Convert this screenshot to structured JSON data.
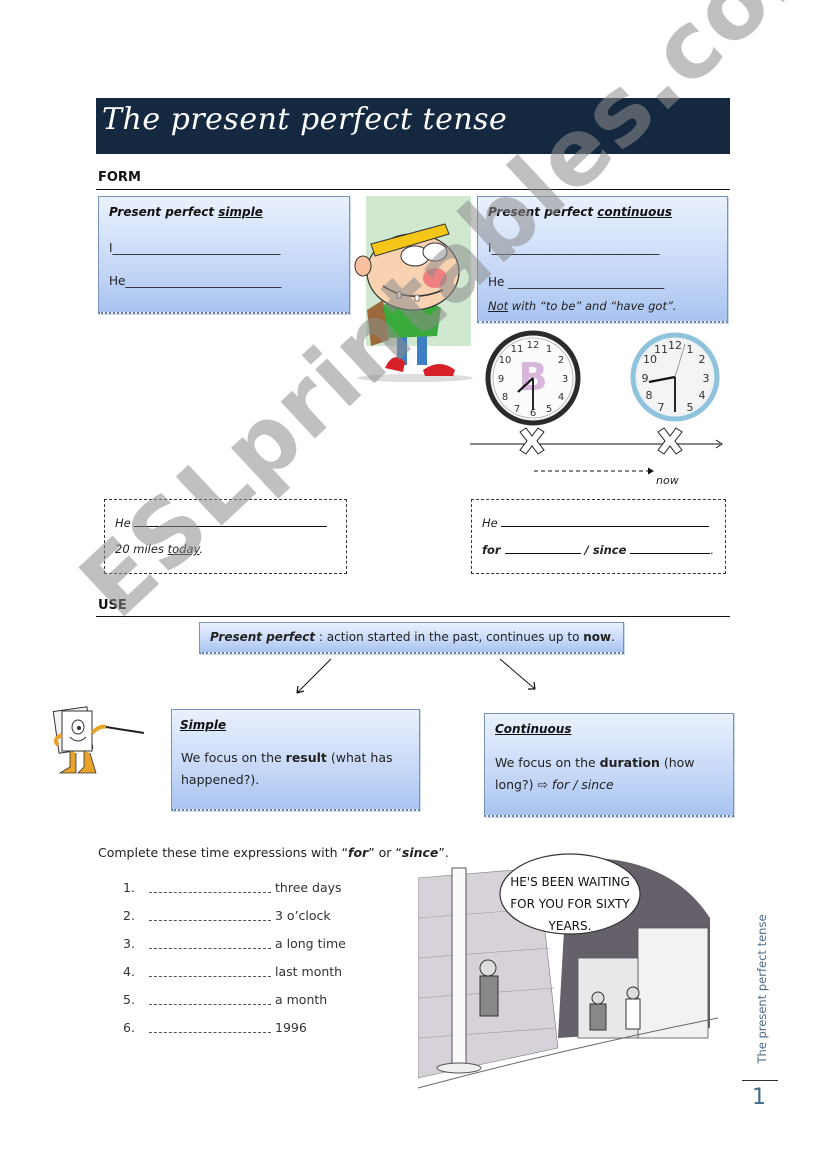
{
  "title": "The present perfect tense",
  "form": {
    "heading": "FORM",
    "simple_box": {
      "title_prefix": "Present perfect ",
      "title_emph": "simple",
      "line1_label": "I",
      "line1_blank": "____________________________",
      "line2_label": "He",
      "line2_blank": "__________________________"
    },
    "continuous_box": {
      "title_prefix": "Present perfect ",
      "title_emph": "continuous",
      "line1_label": "I",
      "line1_blank": "____________________________",
      "line2_label": "He",
      "line2_blank": " __________________________",
      "note_emph": "Not",
      "note_rest": " with “to be” and “have got”."
    },
    "timeline": {
      "now_label": "now",
      "clock_left_letter": "B"
    },
    "simple_example": {
      "line1_label": "He",
      "line2_text": "20 miles ",
      "line2_emph": "today",
      "line2_end": "."
    },
    "continuous_example": {
      "line1_label": "He",
      "for_label": "for",
      "since_label": "/ since",
      "end": "."
    }
  },
  "use": {
    "heading": "USE",
    "main_box": {
      "title": "Present perfect",
      "text": " : action started in the past, continues up to ",
      "emph": "now",
      "end": "."
    },
    "simple_box": {
      "title": "Simple",
      "text_before": "We focus on the ",
      "emph": "result",
      "text_after": " (what has happened?)."
    },
    "continuous_box": {
      "title": "Continuous",
      "text_before": "We focus on the ",
      "emph": "duration",
      "text_after": " (how long?) ⇨ ",
      "italic": "for / since"
    }
  },
  "exercise": {
    "instruction_before": "Complete these time expressions with “",
    "for": "for",
    "middle": "” or “",
    "since": "since",
    "instruction_after": "”.",
    "items": [
      {
        "num": "1.",
        "text": "three days"
      },
      {
        "num": "2.",
        "text": "3 o’clock"
      },
      {
        "num": "3.",
        "text": "a long time"
      },
      {
        "num": "4.",
        "text": "last month"
      },
      {
        "num": "5.",
        "text": "a month"
      },
      {
        "num": "6.",
        "text": "1996"
      }
    ],
    "cartoon_caption": [
      "HE'S BEEN WAITING",
      "FOR YOU FOR SIXTY",
      "YEARS."
    ]
  },
  "footer": {
    "running_title": "The present perfect tense",
    "page_number": "1"
  },
  "watermark": "ESLprintables.com"
}
